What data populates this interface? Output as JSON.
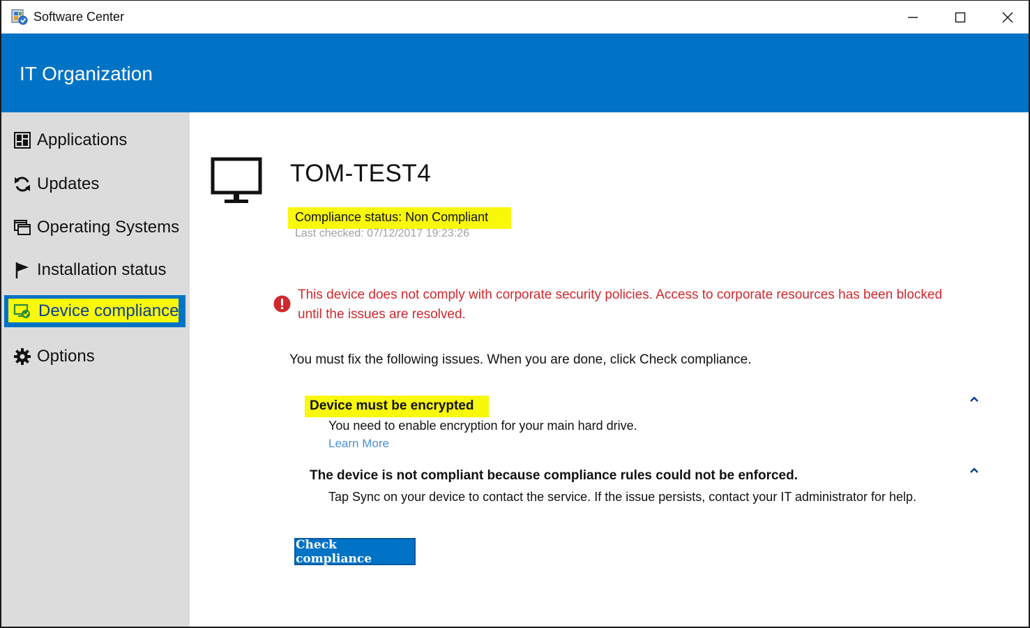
{
  "window": {
    "title": "Software Center",
    "app_icon": "software-center-icon",
    "controls": [
      "minimize-icon",
      "maximize-icon",
      "close-icon"
    ]
  },
  "header": {
    "org_name": "IT Organization",
    "color": "#0173c7"
  },
  "sidebar": {
    "items": [
      {
        "label": "Applications",
        "icon": "applications-grid-icon"
      },
      {
        "label": "Updates",
        "icon": "refresh-icon"
      },
      {
        "label": "Operating Systems",
        "icon": "windows-stack-icon"
      },
      {
        "label": "Installation status",
        "icon": "flag-icon"
      },
      {
        "label": "Device compliance",
        "icon": "device-compliance-icon",
        "active": true
      },
      {
        "label": "Options",
        "icon": "gear-icon"
      }
    ]
  },
  "main": {
    "device_name": "TOM-TEST4",
    "compliance_status": "Compliance status: Non Compliant",
    "last_checked": "Last checked: 07/12/2017 19:23:26",
    "alert_text": "This device does not comply with corporate security policies. Access to corporate resources has been blocked until the issues are resolved.",
    "instructions": "You must fix the following issues. When you are done, click Check compliance.",
    "issues": [
      {
        "title": "Device must be encrypted",
        "description": "You need to enable encryption for your main hard drive.",
        "link": "Learn More"
      },
      {
        "title": "The device is not compliant because compliance rules could not be enforced.",
        "description": "Tap Sync on your device to contact the service. If the issue persists, contact your IT administrator for help."
      }
    ],
    "check_button": "Check compliance"
  },
  "colors": {
    "accent": "#0173c7",
    "sidebar_bg": "#dcdcdc",
    "error": "#d0282e",
    "highlight": "#f8f80a",
    "link": "#4a8fd6"
  }
}
